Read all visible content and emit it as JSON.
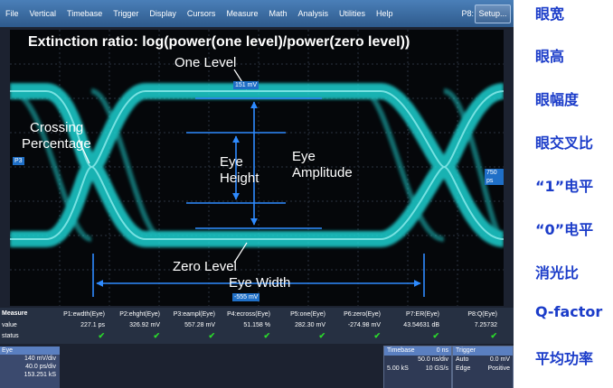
{
  "menu": {
    "items": [
      "File",
      "Vertical",
      "Timebase",
      "Trigger",
      "Display",
      "Cursors",
      "Measure",
      "Math",
      "Analysis",
      "Utilities",
      "Help"
    ],
    "p8": "P8:",
    "setup": "Setup..."
  },
  "screen": {
    "title": "Extinction ratio:   log(power(one level)/power(zero level))",
    "one_level": "One Level",
    "crossing1": "Crossing",
    "crossing2": "Percentage",
    "eye_height1": "Eye",
    "eye_height2": "Height",
    "eye_amp1": "Eye",
    "eye_amp2": "Amplitude",
    "zero_level": "Zero Level",
    "eye_width": "Eye Width",
    "tag_top": "151 mV",
    "tag_bottom": "-555 mV",
    "tag_left": "P3",
    "tag_right": "750 ps",
    "colors": {
      "trace": "#1fd0d0",
      "marker": "#2e8bff"
    }
  },
  "measure": {
    "title": "Measure",
    "row_value": "value",
    "row_status": "status",
    "columns": [
      {
        "name": "P1:ewdth(Eye)",
        "value": "227.1 ps"
      },
      {
        "name": "P2:ehght(Eye)",
        "value": "326.92 mV"
      },
      {
        "name": "P3:eampl(Eye)",
        "value": "557.28 mV"
      },
      {
        "name": "P4:ecross(Eye)",
        "value": "51.158 %"
      },
      {
        "name": "P5:one(Eye)",
        "value": "282.30 mV"
      },
      {
        "name": "P6:zero(Eye)",
        "value": "-274.98 mV"
      },
      {
        "name": "P7:ER(Eye)",
        "value": "43.54631 dB"
      },
      {
        "name": "P8:Q(Eye)",
        "value": "7.25732"
      }
    ],
    "check": "✔"
  },
  "eye_box": {
    "title": "Eye",
    "lines": [
      "140 mV/div",
      "40.0 ps/div",
      "153.251 kS"
    ]
  },
  "timebase": {
    "title": "Timebase",
    "title_val": "0 ns",
    "r1": [
      "",
      "50.0 ns/div"
    ],
    "r2": [
      "5.00 kS",
      "10 GS/s"
    ]
  },
  "trigger": {
    "title": "Trigger",
    "r1": [
      "Auto",
      "0.0 mV"
    ],
    "r2": [
      "Edge",
      "Positive"
    ]
  },
  "side_labels": [
    "眼宽",
    "眼高",
    "眼幅度",
    "眼交叉比",
    "“1”电平",
    "“0”电平",
    "消光比",
    "Q-factor",
    "平均功率"
  ]
}
